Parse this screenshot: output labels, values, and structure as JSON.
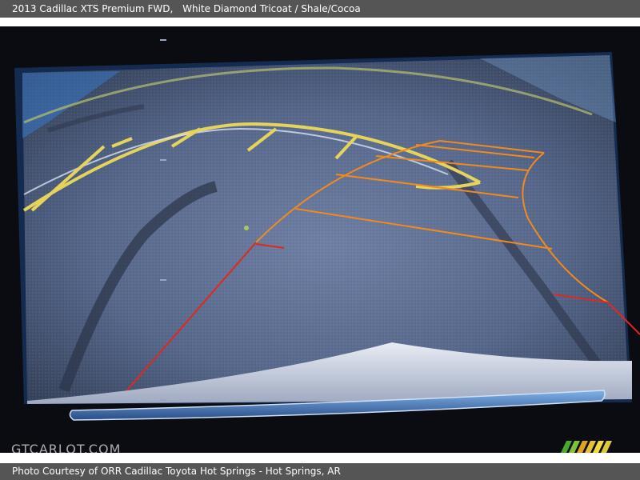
{
  "header": {
    "car": "2013 Cadillac XTS Premium FWD,",
    "color": "White Diamond Tricoat / Shale/Cocoa"
  },
  "watermark": "GTCARLOT.COM",
  "footer": {
    "credit": "Photo Courtesy of ORR Cadillac Toyota Hot Springs - Hot Springs, AR"
  },
  "colors": {
    "guide_orange": "#f08a1e",
    "guide_red": "#e0281c",
    "guide_yellow": "#e8c83a",
    "pavement": "#5a6a88",
    "bezel": "#0a0c12"
  },
  "icons": {
    "site_logo": "striped-flag-icon"
  }
}
